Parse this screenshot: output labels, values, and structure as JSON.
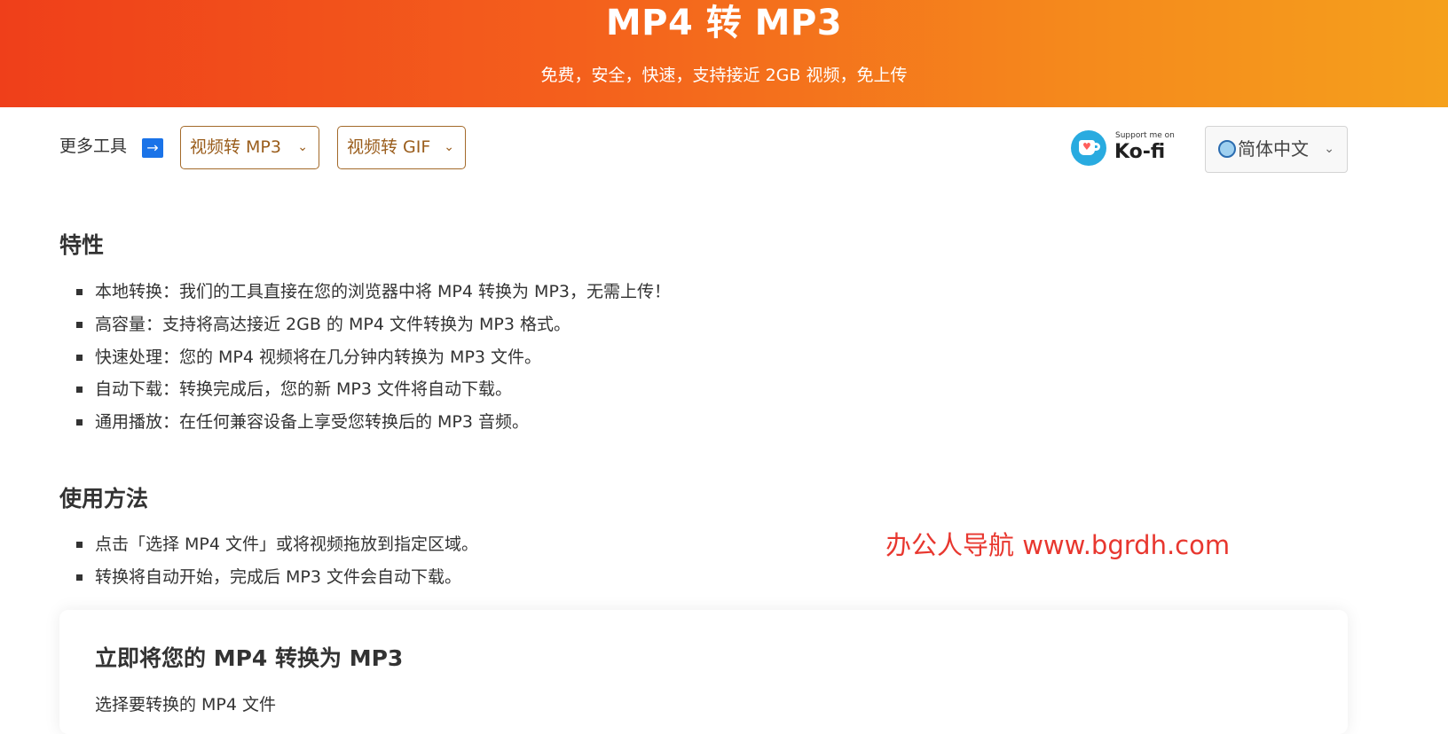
{
  "hero": {
    "title": "MP4 转 MP3",
    "subtitle": "免费，安全，快速，支持接近 2GB 视频，免上传"
  },
  "toolbar": {
    "more_tools_label": "更多工具",
    "arrow": "→",
    "tools": [
      {
        "label": "视频转 MP3"
      },
      {
        "label": "视频转 GIF"
      }
    ],
    "kofi": {
      "small": "Support me on",
      "big": "Ko-fi"
    },
    "language": "简体中文"
  },
  "features": {
    "title": "特性",
    "items": [
      "本地转换：我们的工具直接在您的浏览器中将 MP4 转换为 MP3，无需上传！",
      "高容量：支持将高达接近 2GB 的 MP4 文件转换为 MP3 格式。",
      "快速处理：您的 MP4 视频将在几分钟内转换为 MP3 文件。",
      "自动下载：转换完成后，您的新 MP3 文件将自动下载。",
      "通用播放：在任何兼容设备上享受您转换后的 MP3 音频。"
    ]
  },
  "usage": {
    "title": "使用方法",
    "items": [
      "点击「选择 MP4 文件」或将视频拖放到指定区域。",
      "转换将自动开始，完成后 MP3 文件会自动下载。"
    ]
  },
  "watermark": "办公人导航 www.bgrdh.com",
  "converter": {
    "title": "立即将您的 MP4 转换为 MP3",
    "select_label": "选择要转换的 MP4 文件"
  },
  "colors": {
    "hero_gradient_start": "#ef3f1a",
    "hero_gradient_end": "#f5a01c",
    "tool_border": "#a36a2a",
    "watermark": "#e8372f"
  }
}
